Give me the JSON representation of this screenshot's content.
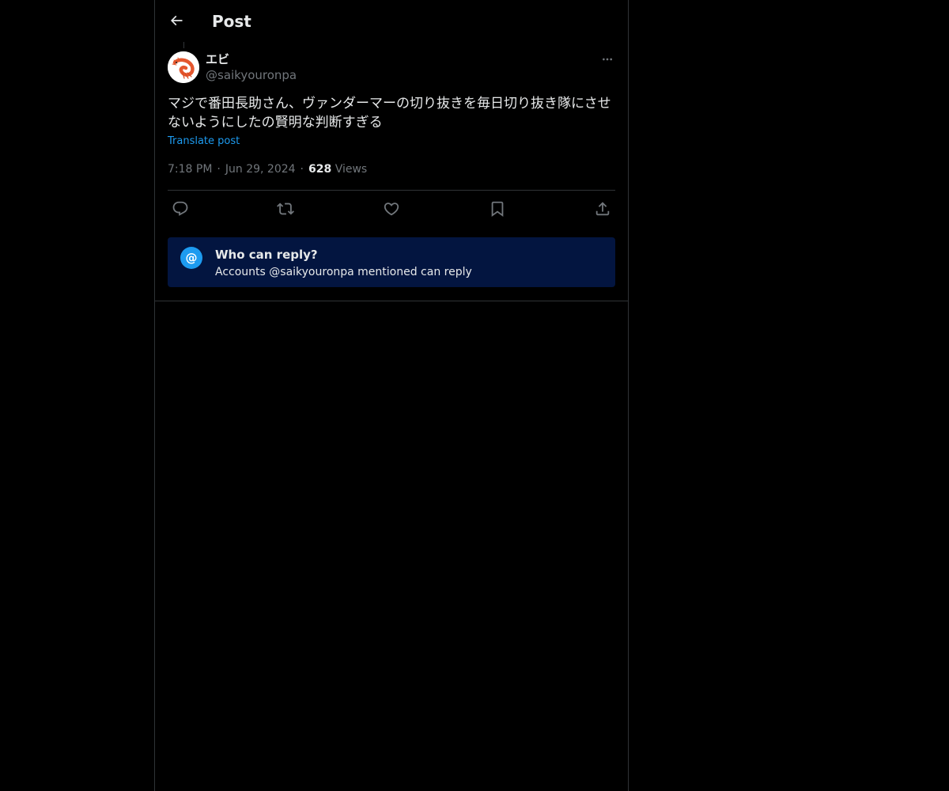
{
  "header": {
    "title": "Post",
    "back_icon": "arrow-left-icon"
  },
  "post": {
    "author_name": "エビ",
    "author_handle": "@saikyouronpa",
    "avatar_icon": "shrimp-avatar",
    "text": "マジで番田長助さん、ヴァンダーマーの切り抜きを毎日切り抜き隊にさせないようにしたの賢明な判断すぎる",
    "translate_label": "Translate post",
    "time": "7:18 PM",
    "date": "Jun 29, 2024",
    "views_count": "628",
    "views_label": "Views",
    "separator": "·"
  },
  "actions": {
    "reply_icon": "reply-icon",
    "repost_icon": "repost-icon",
    "like_icon": "heart-icon",
    "bookmark_icon": "bookmark-icon",
    "share_icon": "share-icon"
  },
  "reply_restriction": {
    "icon_glyph": "@",
    "title": "Who can reply?",
    "description": "Accounts @saikyouronpa mentioned can reply"
  },
  "colors": {
    "background": "#000000",
    "text_primary": "#e7e9ea",
    "text_secondary": "#71767b",
    "accent": "#1d9bf0",
    "border": "#2f3336",
    "reply_box_bg": "#031540"
  }
}
